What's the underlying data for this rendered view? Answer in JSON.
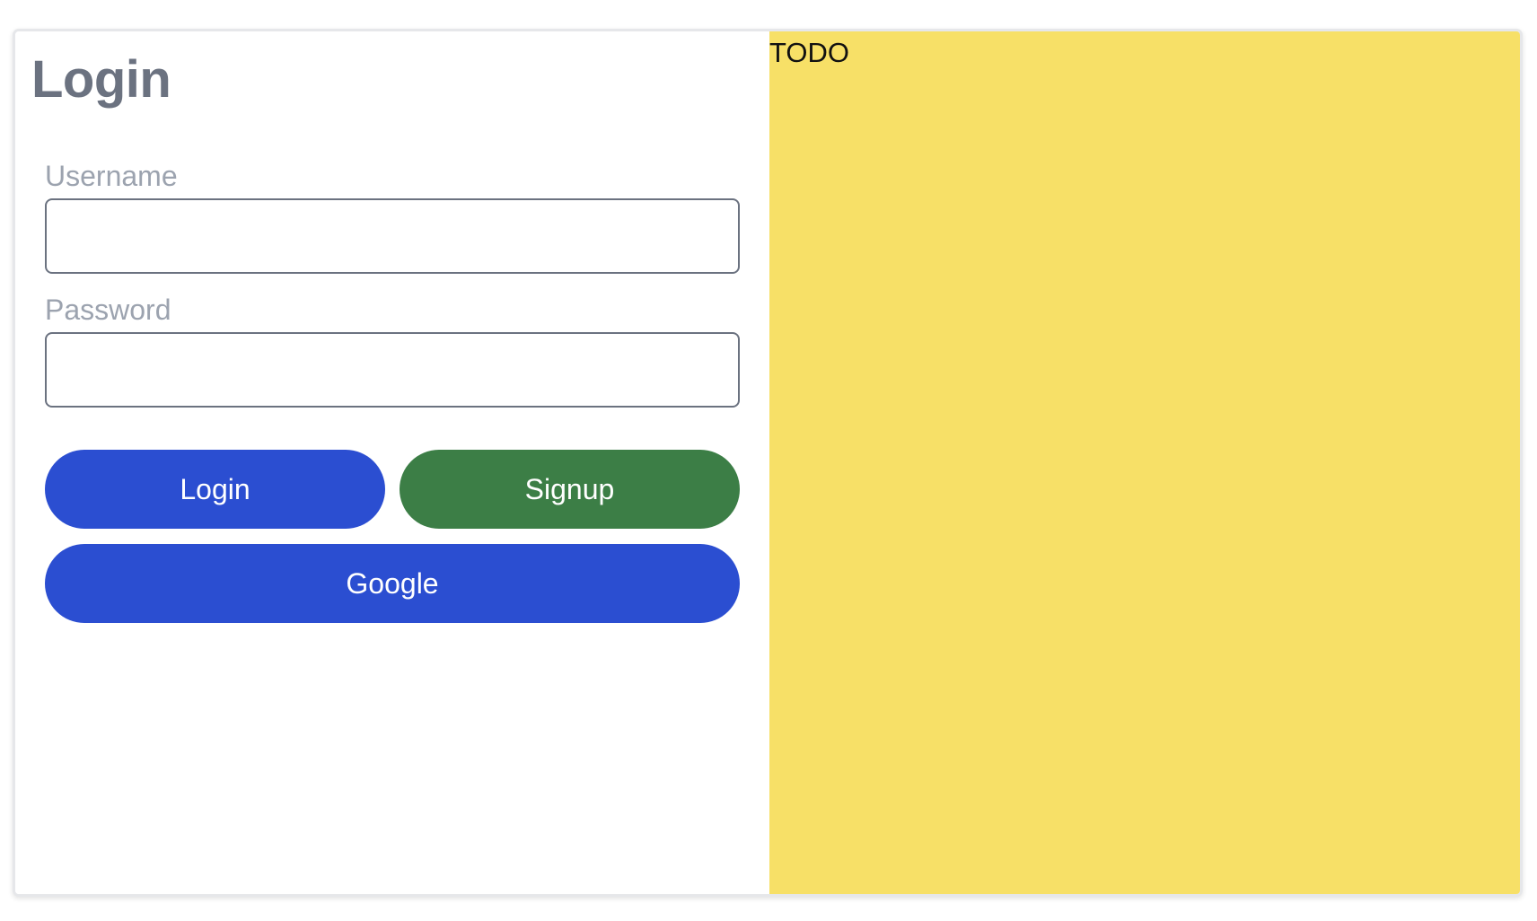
{
  "login_panel": {
    "title": "Login",
    "username": {
      "label": "Username",
      "value": "",
      "placeholder": ""
    },
    "password": {
      "label": "Password",
      "value": "",
      "placeholder": ""
    },
    "buttons": {
      "login_label": "Login",
      "signup_label": "Signup",
      "google_label": "Google"
    }
  },
  "side_panel": {
    "text": "TODO"
  },
  "colors": {
    "primary_blue": "#2b4ed1",
    "signup_green": "#3c7e46",
    "side_panel_yellow": "#f7e067",
    "title_gray": "#6b7280",
    "label_gray": "#9ca3af"
  }
}
